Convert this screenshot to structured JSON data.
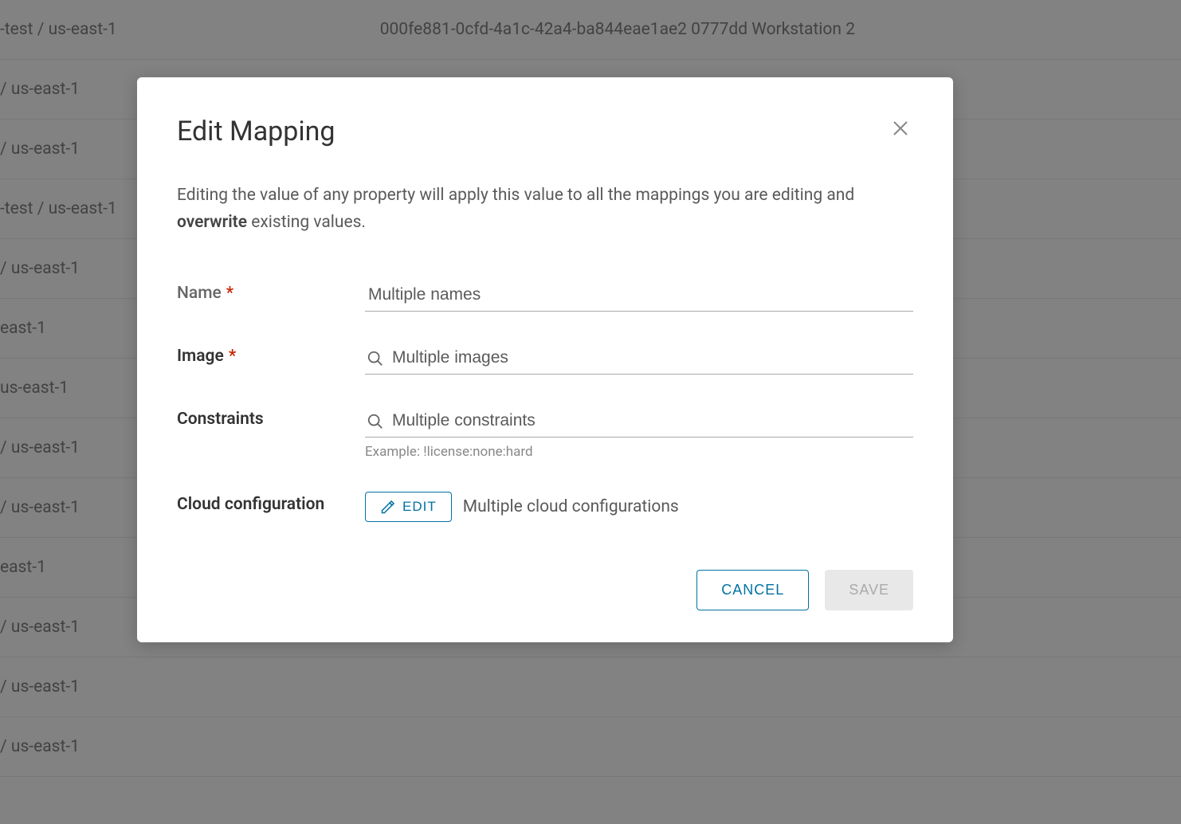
{
  "background": {
    "row0_col1": "-test / us-east-1",
    "row0_col2": "000fe881-0cfd-4a1c-42a4-ba844eae1ae2 0777dd Workstation 2",
    "rows": [
      "/ us-east-1",
      "/ us-east-1",
      "-test / us-east-1",
      "/ us-east-1",
      "east-1",
      "us-east-1",
      "/ us-east-1",
      "/ us-east-1",
      "east-1",
      "/ us-east-1",
      "/ us-east-1",
      "/ us-east-1"
    ]
  },
  "modal": {
    "title": "Edit Mapping",
    "description_part1": "Editing the value of any property will apply this value to all the mappings you are editing and ",
    "description_bold": "overwrite",
    "description_part2": " existing values.",
    "fields": {
      "name": {
        "label": "Name",
        "value": "Multiple names"
      },
      "image": {
        "label": "Image",
        "placeholder": "Multiple images"
      },
      "constraints": {
        "label": "Constraints",
        "placeholder": "Multiple constraints",
        "hint": "Example: !license:none:hard"
      },
      "cloud_config": {
        "label": "Cloud configuration",
        "edit_button": "EDIT",
        "text": "Multiple cloud configurations"
      }
    },
    "footer": {
      "cancel": "CANCEL",
      "save": "SAVE"
    }
  }
}
